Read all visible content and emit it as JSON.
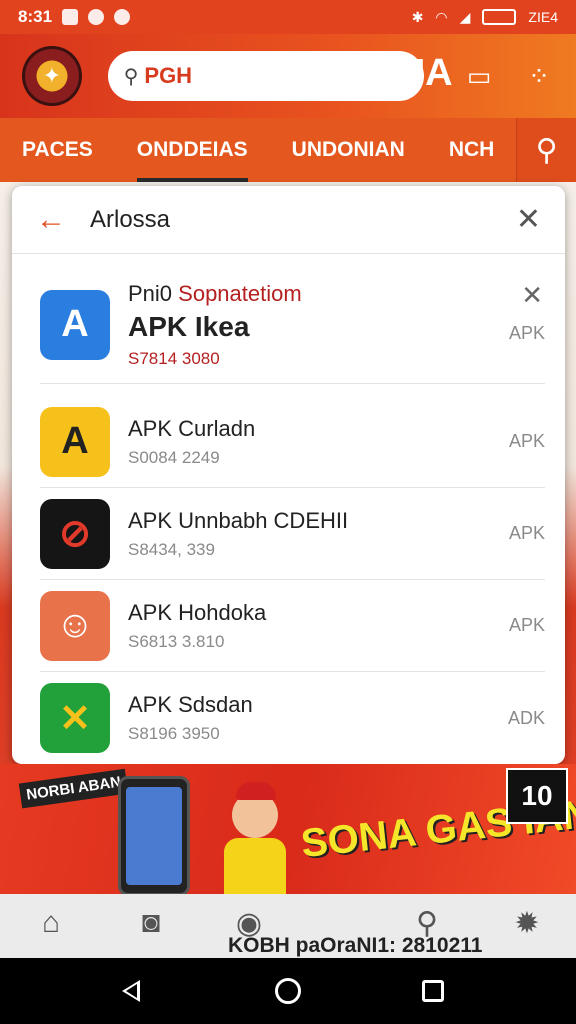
{
  "status_bar": {
    "time": "8:31",
    "right_text": "ZIE4"
  },
  "header": {
    "search_prefix": "PGH",
    "brand_text": "Y INDONUA",
    "icons": [
      "share-icon",
      "more-icon"
    ]
  },
  "tabs": [
    {
      "label": "PACES",
      "active": false
    },
    {
      "label": "ONDDEIAS",
      "active": true
    },
    {
      "label": "UNDONIAN",
      "active": false
    },
    {
      "label": "NCH",
      "active": false
    }
  ],
  "dialog": {
    "title": "Arlossa",
    "items": [
      {
        "subtitle_a": "Pni0 ",
        "subtitle_b": "Sopnatetiom",
        "name": "APK Ikea",
        "price": "S7814 3080",
        "tag": "APK",
        "icon_color": "#2a7ee0",
        "icon_glyph": "A"
      },
      {
        "name": "APK Curladn",
        "price": "S0084 2249",
        "tag": "APK",
        "icon_color": "#f5c11a",
        "icon_glyph": "A"
      },
      {
        "name": "APK Unnbabh CDEHII",
        "price": "S8434, 339",
        "tag": "APK",
        "icon_color": "#151515",
        "icon_glyph": "⊘"
      },
      {
        "name": "APK Hohdoka",
        "price": "S6813 3.810",
        "tag": "APK",
        "icon_color": "#e8734a",
        "icon_glyph": "☺"
      },
      {
        "name": "APK Sdsdan",
        "price": "S8196 3950",
        "tag": "ADK",
        "icon_color": "#22a03a",
        "icon_glyph": "✕"
      }
    ]
  },
  "banner": {
    "left_text": "NORBI ABAN",
    "title": "SONA GAS IANDRNAOZ",
    "badge": "10"
  },
  "bottom_nav": {
    "caption": "KOBH paOraNI1: 2810211"
  }
}
